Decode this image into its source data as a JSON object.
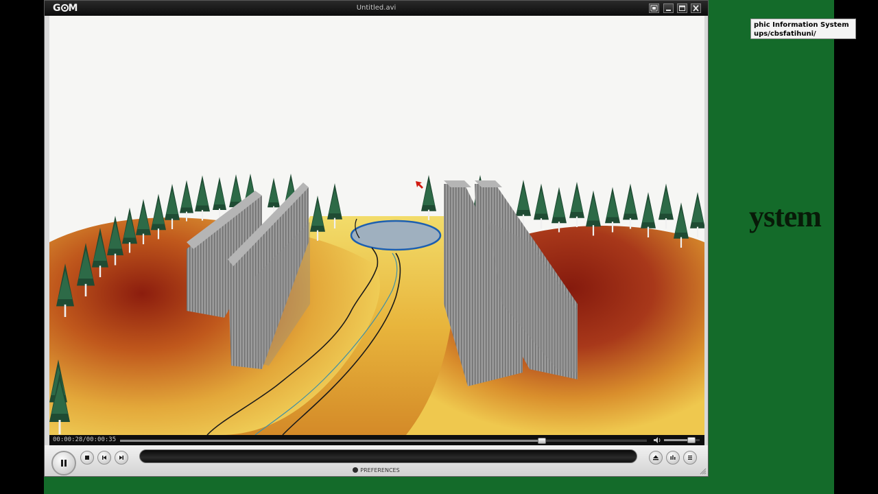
{
  "background": {
    "tooltip_line1": "phic Information System",
    "tooltip_line2": "ups/cbsfatihuni/",
    "big_text": "ystem",
    "color": "#146b2a"
  },
  "player": {
    "app_name": "GOM Player",
    "logo_left": "G",
    "logo_right": "M",
    "title": "Untitled.avi",
    "window_buttons": {
      "fullscreen": "fullscreen-icon",
      "minimize": "minimize-icon",
      "maximize": "maximize-icon",
      "close": "close-icon"
    },
    "seek": {
      "time_text": "00:00:28/00:00:35",
      "progress": 0.8
    },
    "volume": {
      "level": 0.75
    },
    "controls": {
      "play_pause": "pause-icon",
      "stop": "stop-icon",
      "prev": "previous-icon",
      "next": "next-icon",
      "eject": "eject-icon",
      "settings": "equalizer-icon",
      "playlist": "playlist-icon"
    },
    "preferences_label": "PREFERENCES"
  },
  "colors": {
    "sky": "#f6f6f4",
    "terrain_yellow": "#e7b43a",
    "terrain_red": "#8f1f10",
    "building_gray": "#9a9a9a",
    "tree_green": "#1f4b33",
    "lake_blue": "#9fb0bf"
  }
}
